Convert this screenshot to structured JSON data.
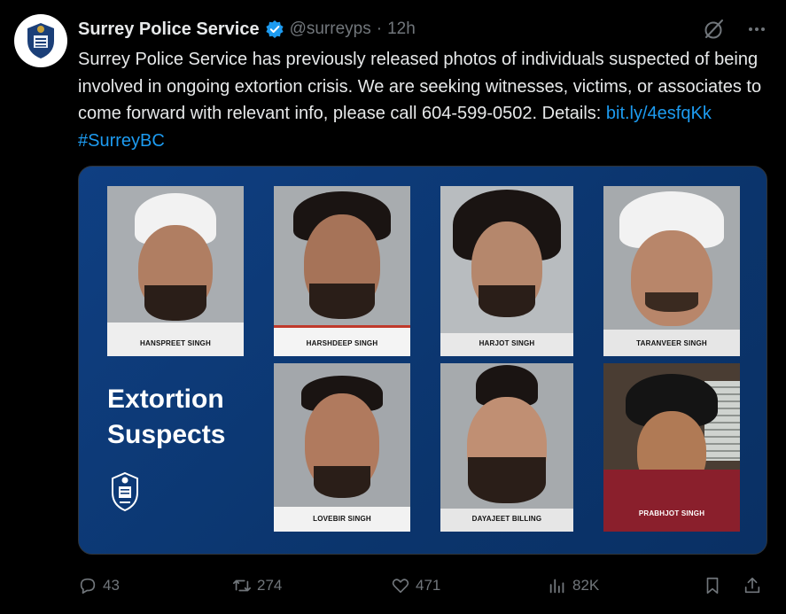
{
  "author": {
    "name": "Surrey Police Service",
    "handle": "@surreyps",
    "separator": "·",
    "time": "12h"
  },
  "tweet": {
    "text": "Surrey Police Service has previously released photos of individuals suspected of being involved in ongoing extortion crisis. We are seeking witnesses, victims, or associates to come forward with relevant info, please call 604-599-0502. Details: ",
    "link": "bit.ly/4esfqKk",
    "hashtag": "#SurreyBC"
  },
  "media": {
    "title_line1": "Extortion",
    "title_line2": "Suspects",
    "suspects": [
      "HANSPREET SINGH",
      "HARSHDEEP SINGH",
      "HARJOT SINGH",
      "TARANVEER SINGH",
      "LOVEBIR SINGH",
      "DAYAJEET BILLING",
      "PRABHJOT SINGH"
    ]
  },
  "actions": {
    "replies": "43",
    "reposts": "274",
    "likes": "471",
    "views": "82K"
  },
  "colors": {
    "accent": "#1d9bf0",
    "muted": "#71767b",
    "media_bg": "#0e3a76"
  }
}
